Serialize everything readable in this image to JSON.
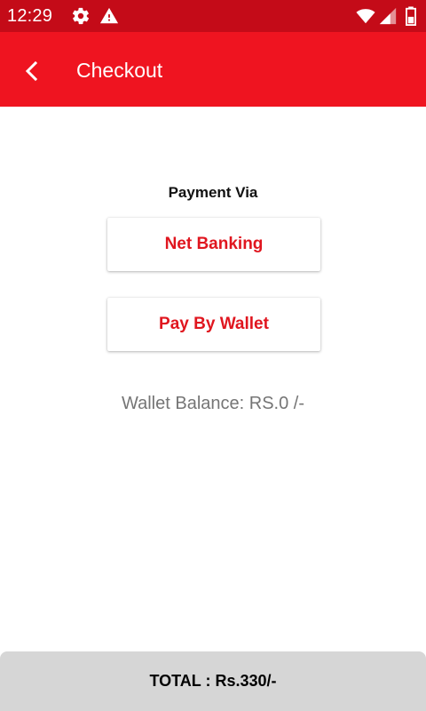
{
  "status_bar": {
    "time": "12:29",
    "icons": [
      "gear-icon",
      "warning-icon",
      "wifi-icon",
      "cellular-icon",
      "battery-icon"
    ],
    "background_color": "#c40b18"
  },
  "app_bar": {
    "title": "Checkout",
    "back_icon": "chevron-left-icon",
    "background_color": "#ef1420"
  },
  "payment": {
    "heading": "Payment Via",
    "net_banking_label": "Net Banking",
    "wallet_label": "Pay By Wallet",
    "button_text_color": "#e0161f"
  },
  "wallet": {
    "balance_text": "Wallet Balance: RS.0 /-"
  },
  "footer": {
    "total_text": "TOTAL : Rs.330/-"
  }
}
